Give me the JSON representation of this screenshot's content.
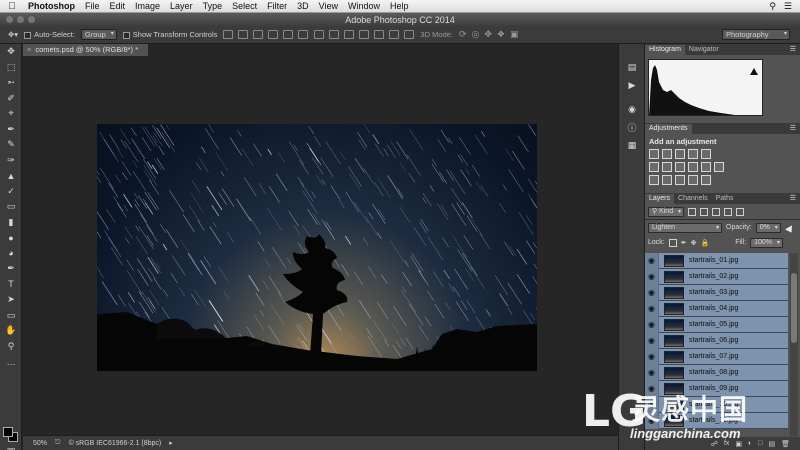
{
  "menubar": {
    "app_name": "Photoshop",
    "items": [
      "File",
      "Edit",
      "Image",
      "Layer",
      "Type",
      "Select",
      "Filter",
      "3D",
      "View",
      "Window",
      "Help"
    ]
  },
  "titlebar": {
    "title": "Adobe Photoshop CC 2014"
  },
  "options_bar": {
    "auto_select_label": "Auto-Select:",
    "auto_select_value": "Group",
    "show_transform_label": "Show Transform Controls",
    "mode_3d_label": "3D Mode:",
    "workspace": "Photography"
  },
  "document": {
    "tab_title": "comets.psd @ 50% (RGB/8*) *",
    "close_glyph": "×"
  },
  "status_bar": {
    "zoom": "50%",
    "profile": "sRGB IEC61966-2.1 (8bpc)"
  },
  "panels": {
    "top_tabs": [
      "Histogram",
      "Navigator"
    ],
    "adjustments_tab": "Adjustments",
    "adjustments_title": "Add an adjustment",
    "layer_tabs": [
      "Layers",
      "Channels",
      "Paths"
    ],
    "filter_kind": "Kind",
    "blend_mode": "Lighten",
    "opacity_label": "Opacity:",
    "opacity_value": "0%",
    "lock_label": "Lock:",
    "fill_label": "Fill:",
    "fill_value": "100%"
  },
  "layers": [
    "startrails_01.jpg",
    "startrails_02.jpg",
    "startrails_03.jpg",
    "startrails_04.jpg",
    "startrails_05.jpg",
    "startrails_06.jpg",
    "startrails_07.jpg",
    "startrails_08.jpg",
    "startrails_09.jpg",
    "startrails_10.jpg",
    "startrails_11.jpg"
  ],
  "icons": {
    "apple": "apple-icon",
    "eye": "eye-icon",
    "move_tool": "move-tool-icon"
  },
  "colors": {
    "layer_selected": "#7e93ad",
    "panel_bg": "#535353",
    "canvas_bg": "#262626"
  },
  "watermark": {
    "brand_mark": "LG",
    "brand_text": "灵感中国",
    "url": "lingganchina.com"
  }
}
